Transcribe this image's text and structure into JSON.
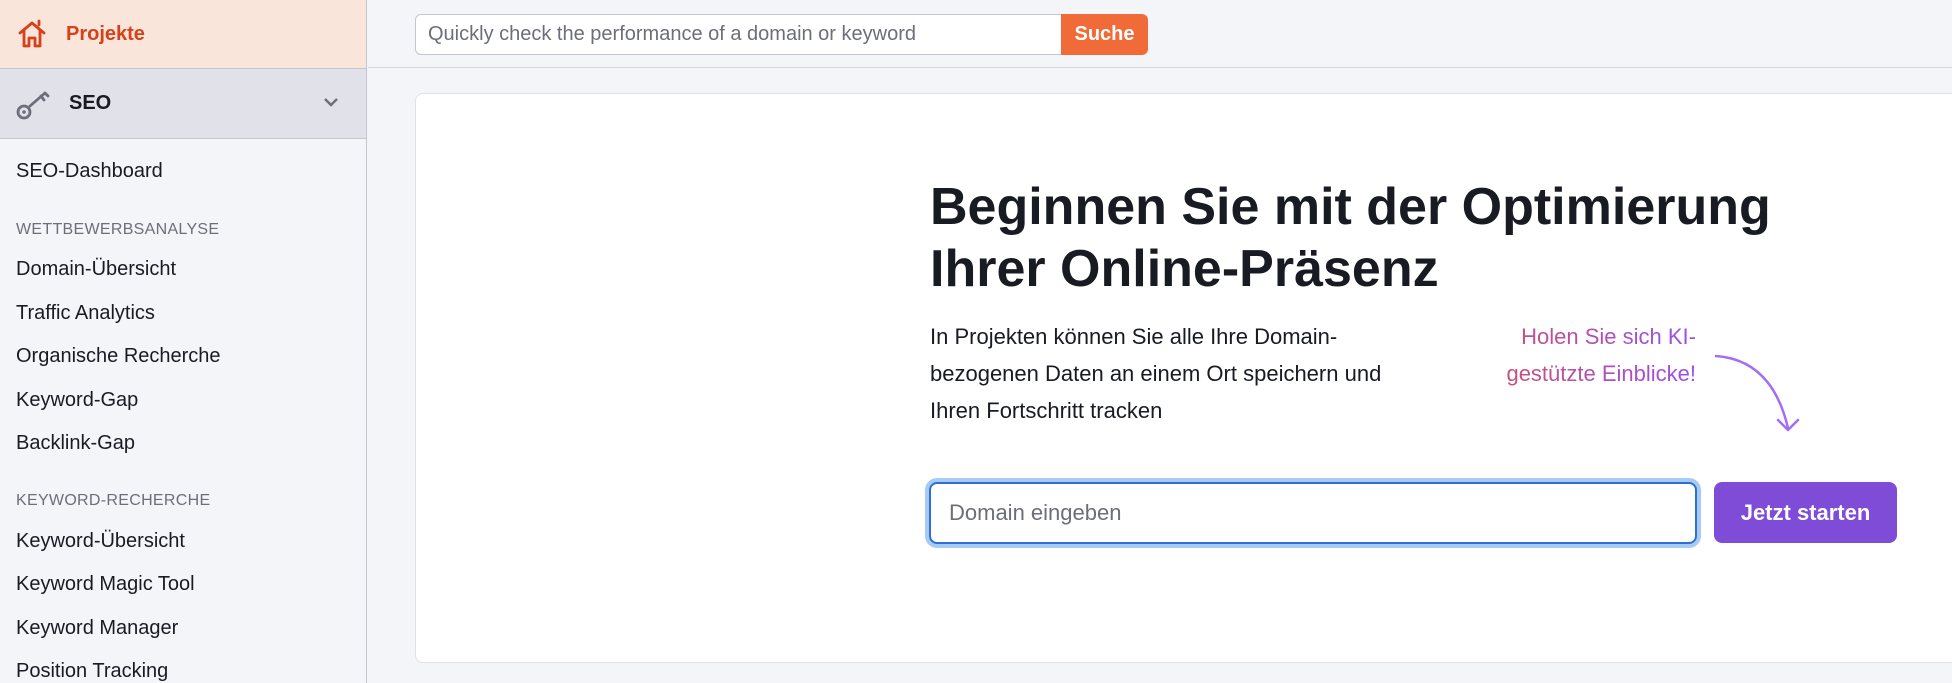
{
  "sidebar": {
    "projects_label": "Projekte",
    "seo_label": "SEO",
    "items": [
      {
        "label": "SEO-Dashboard"
      },
      {
        "section": "WETTBEWERBSANALYSE"
      },
      {
        "label": "Domain-Übersicht"
      },
      {
        "label": "Traffic Analytics"
      },
      {
        "label": "Organische Recherche"
      },
      {
        "label": "Keyword-Gap"
      },
      {
        "label": "Backlink-Gap"
      },
      {
        "section": "KEYWORD-RECHERCHE"
      },
      {
        "label": "Keyword-Übersicht"
      },
      {
        "label": "Keyword Magic Tool"
      },
      {
        "label": "Keyword Manager"
      },
      {
        "label": "Position Tracking"
      }
    ]
  },
  "topbar": {
    "search_placeholder": "Quickly check the performance of a domain or keyword",
    "search_button": "Suche"
  },
  "main": {
    "heading": "Beginnen Sie mit der Optimierung Ihrer Online-Präsenz",
    "description": "In Projekten können Sie alle Ihre Domain-bezogenen Daten an einem Ort speichern und Ihren Fortschritt tracken",
    "ki_line1": "Holen Sie sich KI-",
    "ki_line2": "gestützte Einblicke!",
    "domain_placeholder": "Domain eingeben",
    "start_button": "Jetzt starten"
  },
  "colors": {
    "accent_orange": "#f06b37",
    "accent_purple": "#7f4cd8",
    "projects_red": "#d4421c"
  }
}
